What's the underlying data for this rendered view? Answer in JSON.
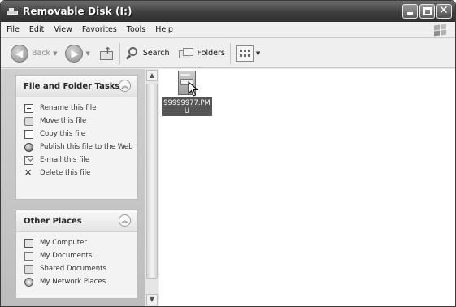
{
  "window": {
    "title": "Removable Disk (I:)"
  },
  "menu": {
    "items": [
      "File",
      "Edit",
      "View",
      "Favorites",
      "Tools",
      "Help"
    ]
  },
  "toolbar": {
    "back_label": "Back",
    "search_label": "Search",
    "folders_label": "Folders"
  },
  "file_tasks": {
    "title": "File and Folder Tasks",
    "items": [
      {
        "label": "Rename this file",
        "icon": "rename-icon"
      },
      {
        "label": "Move this file",
        "icon": "move-icon"
      },
      {
        "label": "Copy this file",
        "icon": "copy-icon"
      },
      {
        "label": "Publish this file to the Web",
        "icon": "publish-web-icon"
      },
      {
        "label": "E-mail this file",
        "icon": "email-icon"
      },
      {
        "label": "Delete this file",
        "icon": "delete-icon"
      }
    ]
  },
  "other_places": {
    "title": "Other Places",
    "items": [
      {
        "label": "My Computer",
        "icon": "my-computer-icon"
      },
      {
        "label": "My Documents",
        "icon": "my-documents-icon"
      },
      {
        "label": "Shared Documents",
        "icon": "shared-documents-icon"
      },
      {
        "label": "My Network Places",
        "icon": "network-places-icon"
      }
    ]
  },
  "files": [
    {
      "name": "99999977.PMU",
      "selected": true
    }
  ]
}
